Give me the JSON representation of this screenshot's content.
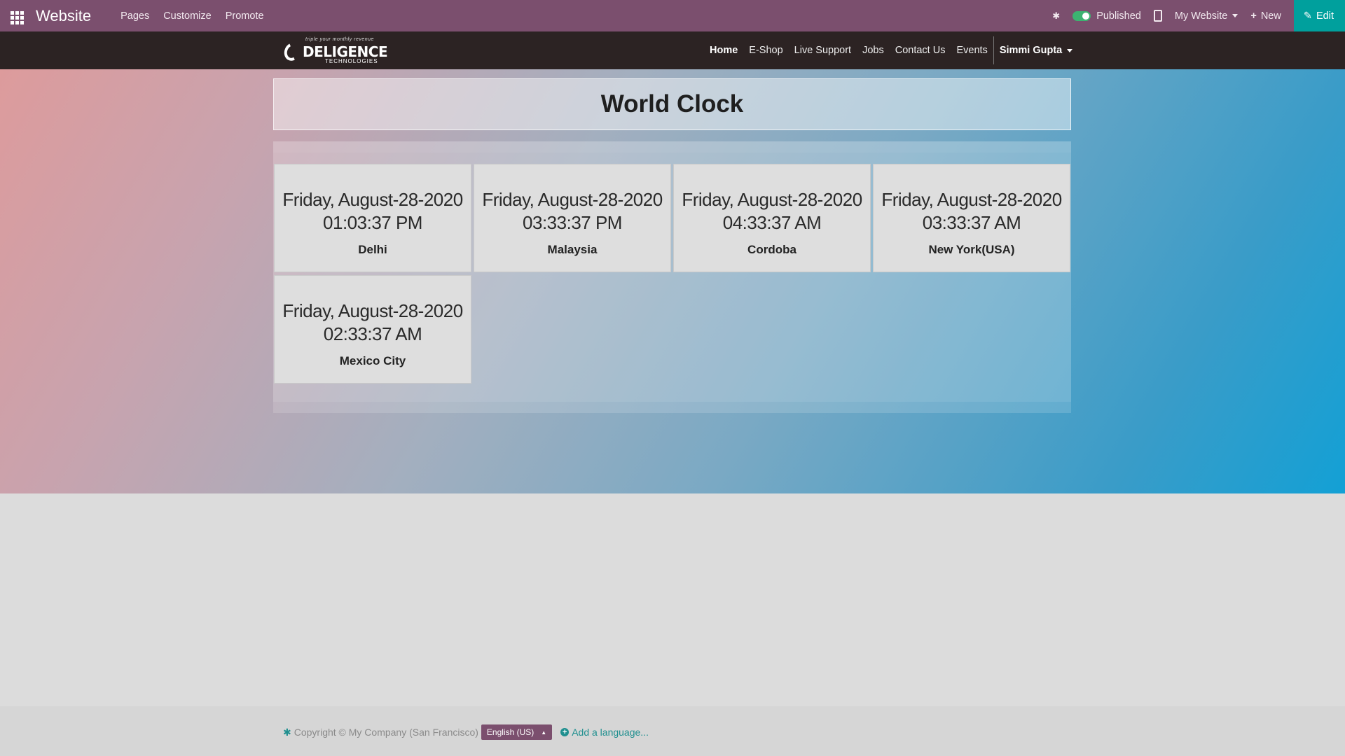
{
  "topbar": {
    "app_name": "Website",
    "menu": [
      "Pages",
      "Customize",
      "Promote"
    ],
    "published_label": "Published",
    "website_selector": "My Website",
    "new_label": "New",
    "edit_label": "Edit",
    "colors": {
      "bar": "#7b4f6e",
      "edit": "#00a09d"
    }
  },
  "sitenav": {
    "logo": {
      "tagline": "triple your monthly revenue",
      "name": "DELIGENCE",
      "sub": "TECHNOLOGIES"
    },
    "links": [
      "Home",
      "E-Shop",
      "Live Support",
      "Jobs",
      "Contact Us",
      "Events"
    ],
    "user": "Simmi Gupta"
  },
  "main": {
    "title": "World Clock",
    "clocks": [
      {
        "datetime": "Friday, August-28-2020 01:03:37 PM",
        "city": "Delhi"
      },
      {
        "datetime": "Friday, August-28-2020 03:33:37 PM",
        "city": "Malaysia"
      },
      {
        "datetime": "Friday, August-28-2020 04:33:37 AM",
        "city": "Cordoba"
      },
      {
        "datetime": "Friday, August-28-2020 03:33:37 AM",
        "city": "New York(USA)"
      },
      {
        "datetime": "Friday, August-28-2020 02:33:37 AM",
        "city": "Mexico City"
      }
    ]
  },
  "footer": {
    "copyright": "Copyright © My Company (San Francisco)",
    "language": "English (US)",
    "add_language": "Add a language..."
  }
}
